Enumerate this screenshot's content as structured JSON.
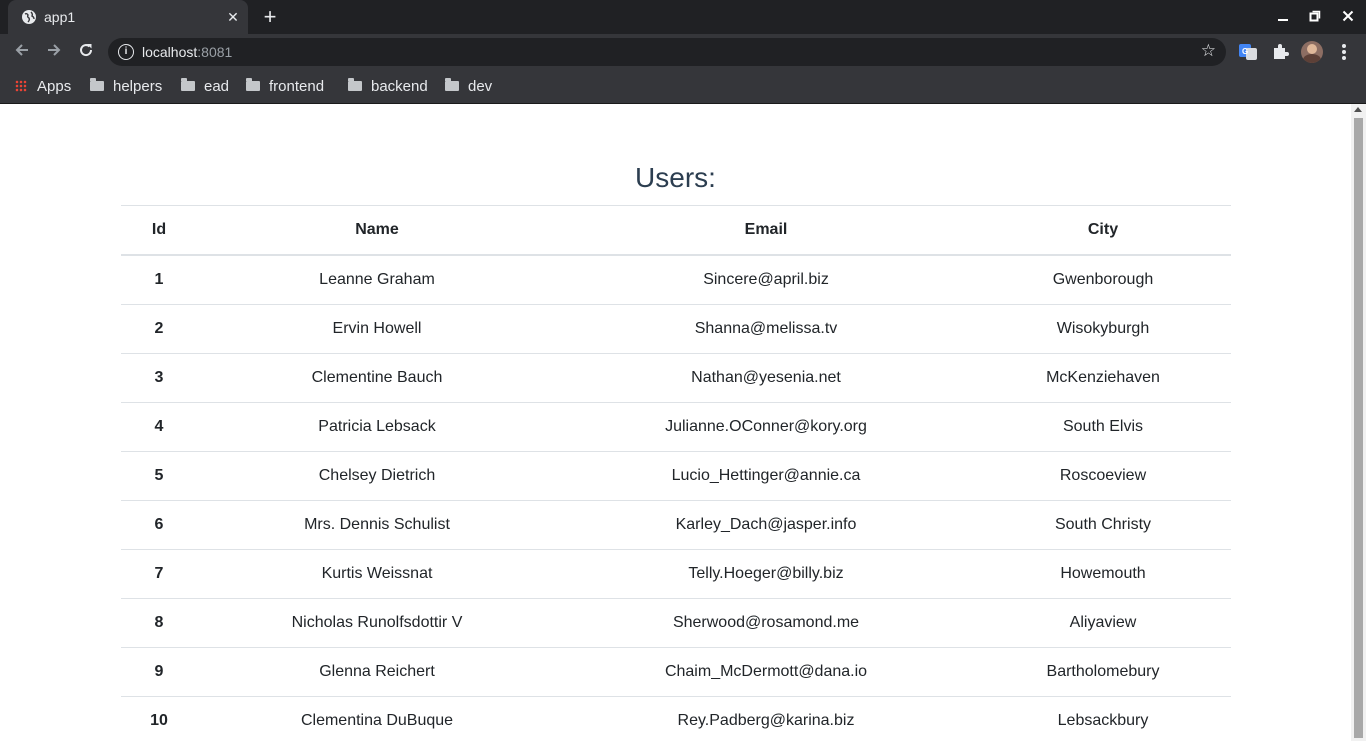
{
  "browser": {
    "tab": {
      "title": "app1"
    },
    "url": {
      "host": "localhost",
      "port": ":8081"
    },
    "bookmarks": [
      "Apps",
      "helpers",
      "ead",
      "frontend",
      "backend",
      "dev"
    ]
  },
  "page": {
    "title": "Users:",
    "columns": [
      "Id",
      "Name",
      "Email",
      "City"
    ],
    "rows": [
      [
        "1",
        "Leanne Graham",
        "Sincere@april.biz",
        "Gwenborough"
      ],
      [
        "2",
        "Ervin Howell",
        "Shanna@melissa.tv",
        "Wisokyburgh"
      ],
      [
        "3",
        "Clementine Bauch",
        "Nathan@yesenia.net",
        "McKenziehaven"
      ],
      [
        "4",
        "Patricia Lebsack",
        "Julianne.OConner@kory.org",
        "South Elvis"
      ],
      [
        "5",
        "Chelsey Dietrich",
        "Lucio_Hettinger@annie.ca",
        "Roscoeview"
      ],
      [
        "6",
        "Mrs. Dennis Schulist",
        "Karley_Dach@jasper.info",
        "South Christy"
      ],
      [
        "7",
        "Kurtis Weissnat",
        "Telly.Hoeger@billy.biz",
        "Howemouth"
      ],
      [
        "8",
        "Nicholas Runolfsdottir V",
        "Sherwood@rosamond.me",
        "Aliyaview"
      ],
      [
        "9",
        "Glenna Reichert",
        "Chaim_McDermott@dana.io",
        "Bartholomebury"
      ],
      [
        "10",
        "Clementina DuBuque",
        "Rey.Padberg@karina.biz",
        "Lebsackbury"
      ]
    ]
  }
}
